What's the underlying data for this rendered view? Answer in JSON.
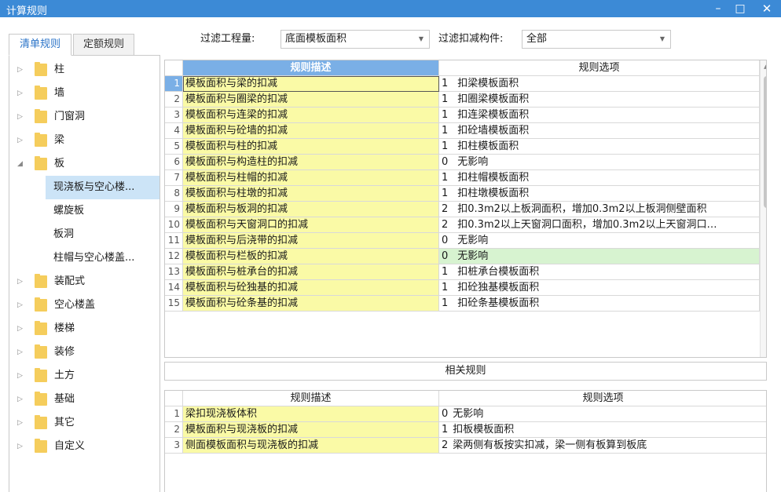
{
  "window": {
    "title": "计算规则",
    "minimize": "–",
    "maximize": "□",
    "close": "✕"
  },
  "tabs": [
    {
      "label": "清单规则",
      "active": true
    },
    {
      "label": "定额规则",
      "active": false
    }
  ],
  "tree": {
    "items": [
      {
        "label": "柱",
        "expanded": false
      },
      {
        "label": "墙",
        "expanded": false
      },
      {
        "label": "门窗洞",
        "expanded": false
      },
      {
        "label": "梁",
        "expanded": false
      },
      {
        "label": "板",
        "expanded": true
      },
      {
        "label": "装配式",
        "expanded": false
      },
      {
        "label": "空心楼盖",
        "expanded": false
      },
      {
        "label": "楼梯",
        "expanded": false
      },
      {
        "label": "装修",
        "expanded": false
      },
      {
        "label": "土方",
        "expanded": false
      },
      {
        "label": "基础",
        "expanded": false
      },
      {
        "label": "其它",
        "expanded": false
      },
      {
        "label": "自定义",
        "expanded": false
      }
    ],
    "children": [
      {
        "label": "现浇板与空心楼...",
        "selected": true
      },
      {
        "label": "螺旋板",
        "selected": false
      },
      {
        "label": "板洞",
        "selected": false
      },
      {
        "label": "柱帽与空心楼盖...",
        "selected": false
      }
    ],
    "collapsed_arrow": "▷",
    "expanded_arrow": "◢"
  },
  "filters": {
    "quantity_label": "过滤工程量:",
    "quantity_value": "底面模板面积",
    "component_label": "过滤扣减构件:",
    "component_value": "全部",
    "caret": "▼"
  },
  "main_table": {
    "headers": {
      "description": "规则描述",
      "options": "规则选项"
    },
    "rows": [
      {
        "num": "1",
        "desc": "模板面积与梁的扣减",
        "code": "1",
        "option": "扣梁模板面积"
      },
      {
        "num": "2",
        "desc": "模板面积与圈梁的扣减",
        "code": "1",
        "option": "扣圈梁模板面积"
      },
      {
        "num": "3",
        "desc": "模板面积与连梁的扣减",
        "code": "1",
        "option": "扣连梁模板面积"
      },
      {
        "num": "4",
        "desc": "模板面积与砼墙的扣减",
        "code": "1",
        "option": "扣砼墙模板面积"
      },
      {
        "num": "5",
        "desc": "模板面积与柱的扣减",
        "code": "1",
        "option": "扣柱模板面积"
      },
      {
        "num": "6",
        "desc": "模板面积与构造柱的扣减",
        "code": "0",
        "option": "无影响"
      },
      {
        "num": "7",
        "desc": "模板面积与柱帽的扣减",
        "code": "1",
        "option": "扣柱帽模板面积"
      },
      {
        "num": "8",
        "desc": "模板面积与柱墩的扣减",
        "code": "1",
        "option": "扣柱墩模板面积"
      },
      {
        "num": "9",
        "desc": "模板面积与板洞的扣减",
        "code": "2",
        "option": "扣0.3m2以上板洞面积，增加0.3m2以上板洞侧壁面积"
      },
      {
        "num": "10",
        "desc": "模板面积与天窗洞口的扣减",
        "code": "2",
        "option": "扣0.3m2以上天窗洞口面积，增加0.3m2以上天窗洞口…"
      },
      {
        "num": "11",
        "desc": "模板面积与后浇带的扣减",
        "code": "0",
        "option": "无影响"
      },
      {
        "num": "12",
        "desc": "模板面积与栏板的扣减",
        "code": "0",
        "option": "无影响"
      },
      {
        "num": "13",
        "desc": "模板面积与桩承台的扣减",
        "code": "1",
        "option": "扣桩承台模板面积"
      },
      {
        "num": "14",
        "desc": "模板面积与砼独基的扣减",
        "code": "1",
        "option": "扣砼独基模板面积"
      },
      {
        "num": "15",
        "desc": "模板面积与砼条基的扣减",
        "code": "1",
        "option": "扣砼条基模板面积"
      }
    ],
    "selected_row": 1,
    "highlighted_row": 12,
    "scroll_up": "▲"
  },
  "related_section": {
    "title": "相关规则"
  },
  "related_table": {
    "headers": {
      "description": "规则描述",
      "options": "规则选项"
    },
    "rows": [
      {
        "num": "1",
        "desc": "梁扣现浇板体积",
        "code": "0",
        "option": "无影响"
      },
      {
        "num": "2",
        "desc": "模板面积与现浇板的扣减",
        "code": "1",
        "option": "扣板模板面积"
      },
      {
        "num": "3",
        "desc": "侧面模板面积与现浇板的扣减",
        "code": "2",
        "option": "梁两侧有板按实扣减，梁一侧有板算到板底"
      }
    ]
  },
  "colors": {
    "titlebar": "#3c8ad6",
    "description_bg": "#fafaa6",
    "header_selected": "#7aafe6",
    "highlight_row": "#d7f3d0",
    "tab_active_text": "#2a73c8",
    "folder": "#f5cd5c"
  }
}
